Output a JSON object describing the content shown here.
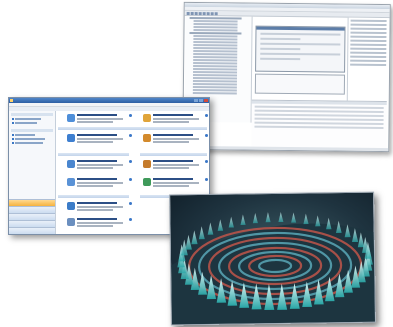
{
  "colors": {
    "ide_accent": "#5c7da8",
    "mgr_titlebar": "#2d5ea3",
    "mgr_selected_nav": "#f5b23e",
    "render_spike": "#7fe6e6",
    "render_wave": "#c0554a"
  },
  "icons": {
    "card_icons": [
      "wrench-icon",
      "server-icon",
      "mail-icon",
      "gear-icon",
      "database-icon",
      "people-icon",
      "arrow-icon",
      "globe-icon",
      "shield-icon",
      "chart-icon"
    ]
  }
}
